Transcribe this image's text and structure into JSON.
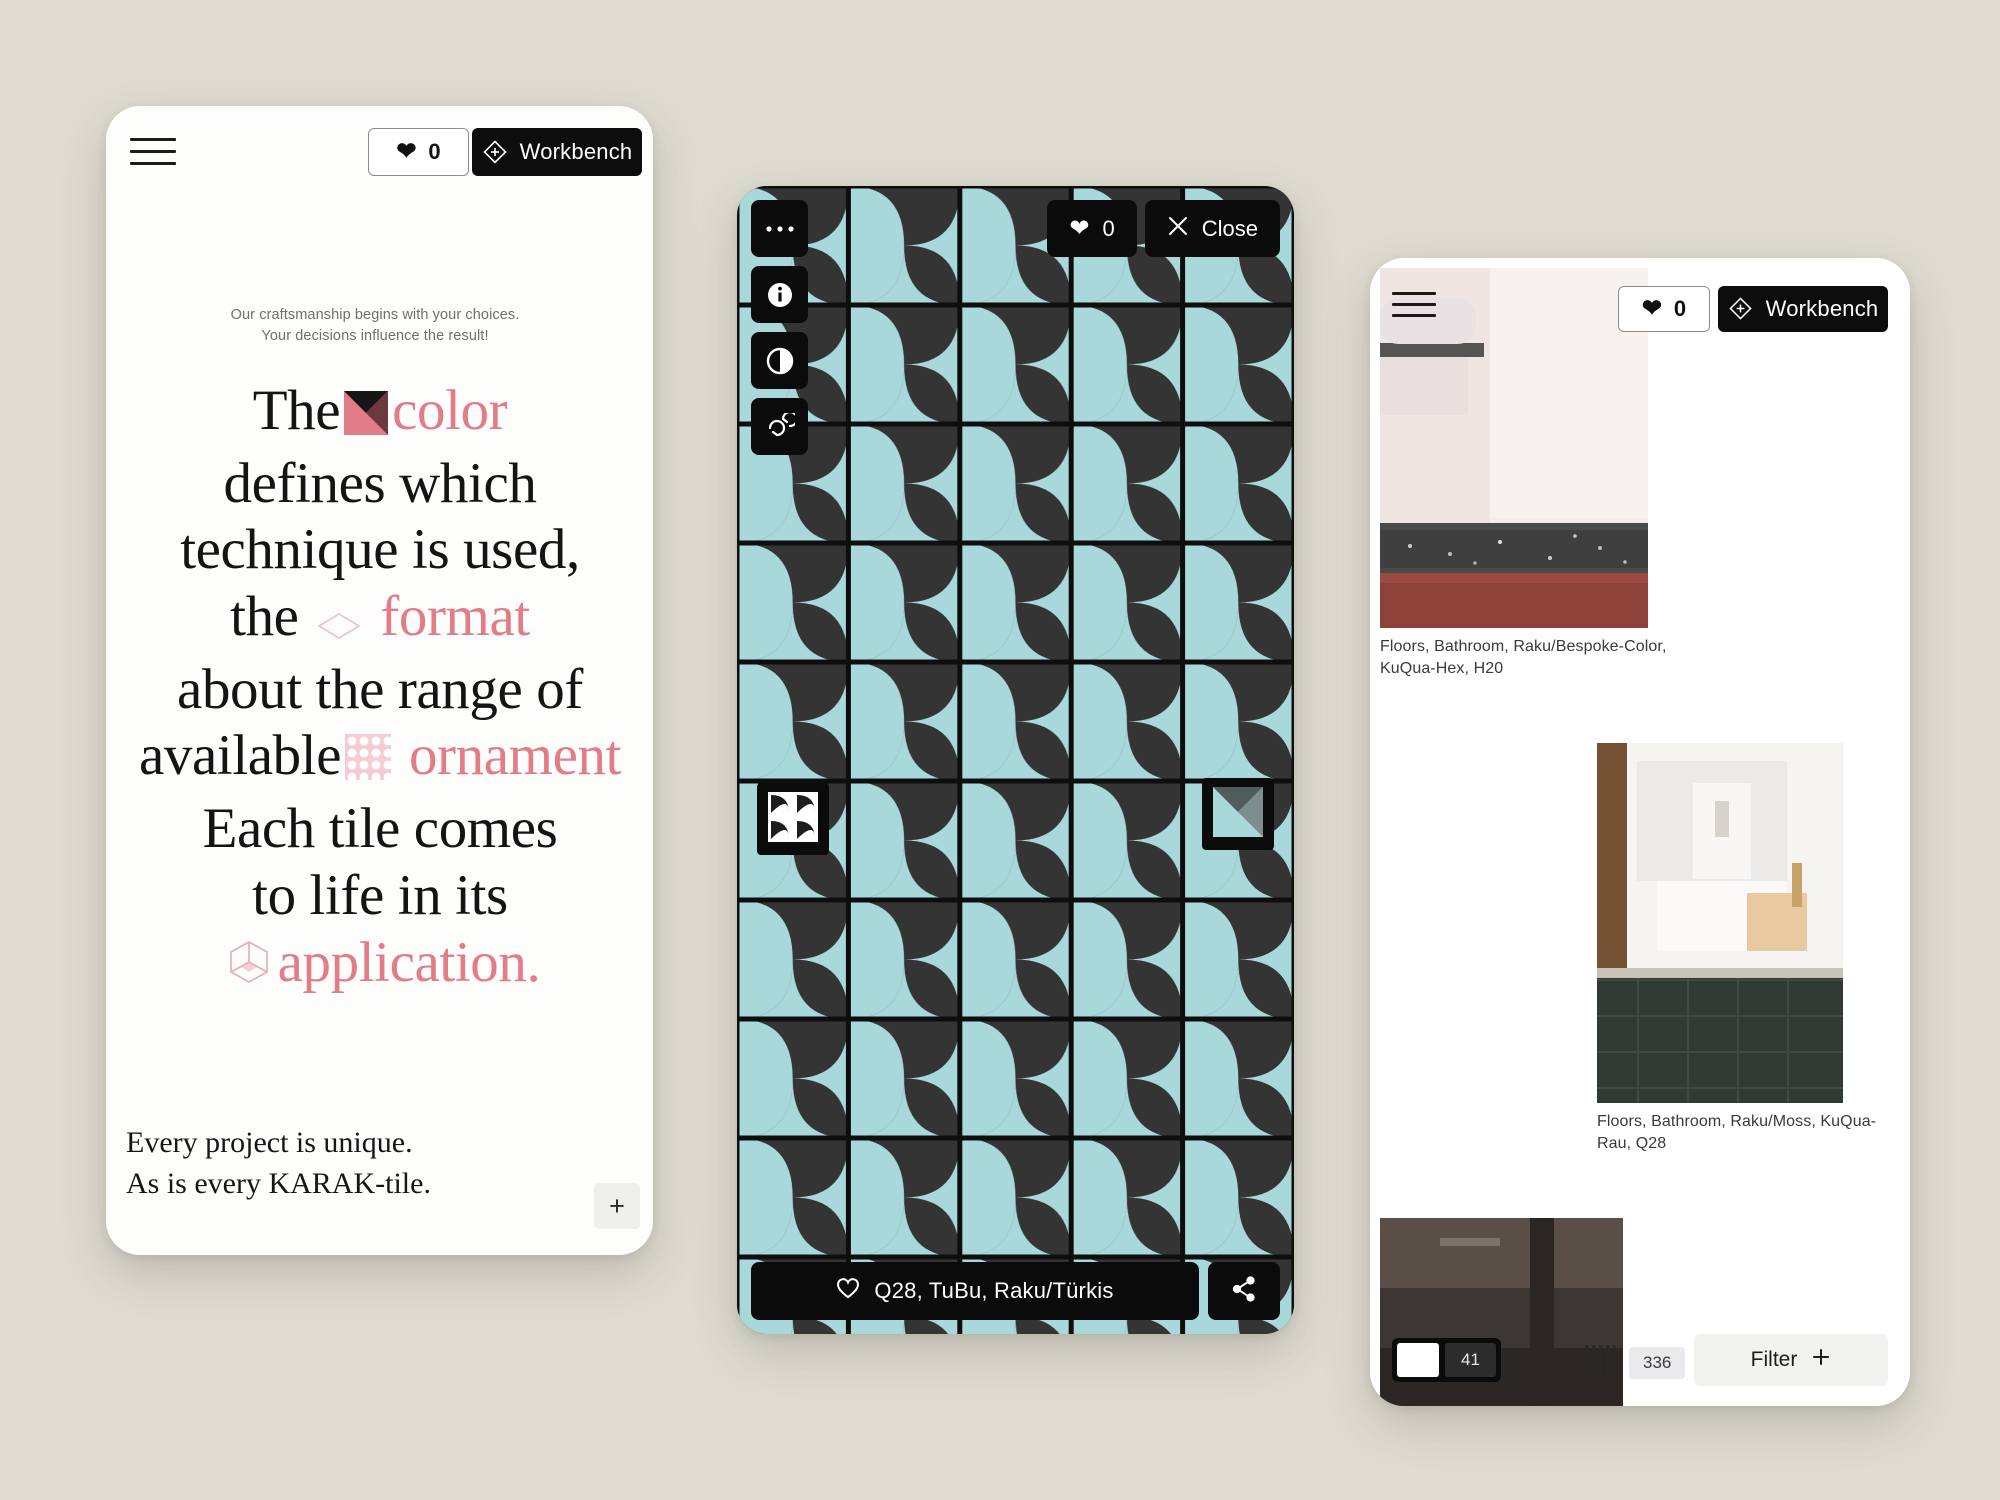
{
  "theme": {
    "page_background": "#dedbd0",
    "accent_pink": "#e27c86",
    "ink": "#111111",
    "tile_turquoise": "#a8d8da",
    "tile_dark": "#343434"
  },
  "panel_home": {
    "name": "Home / intro screen",
    "menu_icon": "hamburger-icon",
    "favorites": {
      "icon": "heart-filled-icon",
      "count": "0"
    },
    "workbench": {
      "icon": "diamond-plus-icon",
      "label": "Workbench"
    },
    "kicker": "Our craftsmanship begins with your choices. Your decisions influence the result!",
    "headline_lines": [
      {
        "parts": [
          {
            "text": "The",
            "style": "ink"
          },
          {
            "text": " ",
            "style": "ink"
          },
          {
            "icon": "color-triangle-icon"
          },
          {
            "text": "color",
            "style": "accent"
          }
        ]
      },
      {
        "parts": [
          {
            "text": "defines which",
            "style": "ink"
          }
        ]
      },
      {
        "parts": [
          {
            "text": "technique is used,",
            "style": "ink"
          }
        ]
      },
      {
        "parts": [
          {
            "text": "the",
            "style": "ink"
          },
          {
            "icon": "diamond-outline-icon"
          },
          {
            "text": "format",
            "style": "accent"
          }
        ]
      },
      {
        "parts": [
          {
            "text": "about the range of",
            "style": "ink"
          }
        ]
      },
      {
        "parts": [
          {
            "text": "available",
            "style": "ink"
          },
          {
            "icon": "ornament-pattern-icon"
          },
          {
            "text": "ornament",
            "style": "accent"
          }
        ]
      },
      {
        "parts": [
          {
            "text": "Each tile comes",
            "style": "ink"
          }
        ]
      },
      {
        "parts": [
          {
            "text": "to life in its",
            "style": "ink"
          }
        ]
      },
      {
        "parts": [
          {
            "icon": "cube-application-icon"
          },
          {
            "text": "application.",
            "style": "accent"
          }
        ]
      }
    ],
    "footer_line_1": "Every project is unique.",
    "footer_line_2": "As is every KARAK-tile.",
    "expand_button": "+"
  },
  "panel_viewer": {
    "name": "Tile pattern viewer",
    "tools": [
      {
        "icon": "ellipsis-icon",
        "label": "More options"
      },
      {
        "icon": "info-icon",
        "label": "Information"
      },
      {
        "icon": "contrast-icon",
        "label": "Contrast"
      },
      {
        "icon": "rotate-icon",
        "label": "Rotate"
      }
    ],
    "favorites": {
      "icon": "heart-filled-icon",
      "count": "0"
    },
    "close": {
      "icon": "close-x-icon",
      "label": "Close"
    },
    "swatch_pattern": {
      "icon": "pattern-swatch-icon"
    },
    "swatch_color": {
      "icon": "color-swatch-icon"
    },
    "caption": {
      "icon": "heart-outline-icon",
      "text": "Q28, TuBu, Raku/Türkis"
    },
    "share": {
      "icon": "share-icon"
    }
  },
  "panel_browse": {
    "name": "Gallery browse screen",
    "menu_icon": "hamburger-icon",
    "favorites": {
      "icon": "heart-filled-icon",
      "count": "0"
    },
    "workbench": {
      "icon": "diamond-plus-icon",
      "label": "Workbench"
    },
    "items": [
      {
        "caption": "Floors, Bathroom, Raku/Bespoke-Color, KuQua-Hex, H20"
      },
      {
        "caption": "Floors, Bathroom, Raku/Moss, KuQua-Rau, Q28"
      }
    ],
    "view_toggle": {
      "icon": "single-view-icon",
      "count": "41"
    },
    "grid_toggle": {
      "icon": "grid-icon",
      "count": "336"
    },
    "filter": {
      "label": "Filter",
      "icon": "plus-icon"
    }
  }
}
